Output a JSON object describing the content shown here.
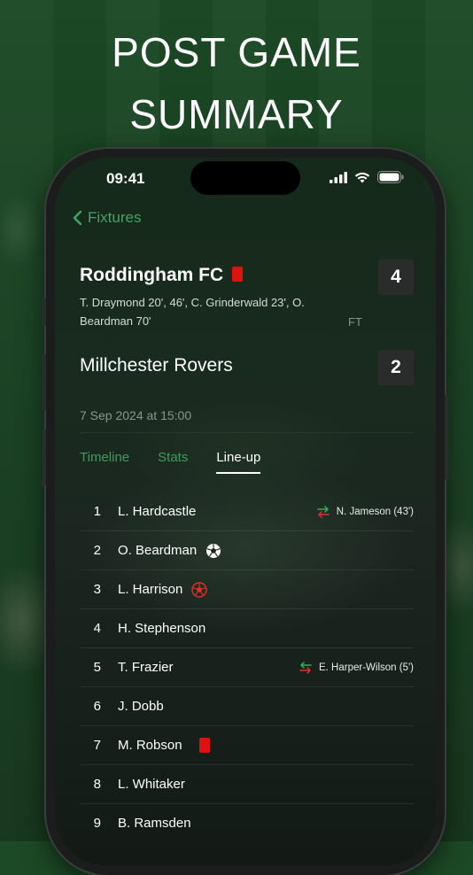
{
  "headline": {
    "line1": "POST GAME",
    "line2": "SUMMARY"
  },
  "status_bar": {
    "time": "09:41"
  },
  "nav": {
    "back_label": "Fixtures"
  },
  "match": {
    "home": {
      "name": "Roddingham FC",
      "score": "4",
      "scorers": "T. Draymond 20', 46', C. Grinderwald 23', O. Beardman 70'"
    },
    "away": {
      "name": "Millchester Rovers",
      "score": "2"
    },
    "status": "FT",
    "datetime": "7 Sep 2024 at 15:00"
  },
  "tabs": [
    {
      "label": "Timeline",
      "active": false
    },
    {
      "label": "Stats",
      "active": false
    },
    {
      "label": "Line-up",
      "active": true
    }
  ],
  "lineup": [
    {
      "number": "1",
      "name": "L. Hardcastle",
      "icon": null,
      "sub": "N. Jameson (43')"
    },
    {
      "number": "2",
      "name": "O. Beardman",
      "icon": "goal-ball-icon",
      "sub": null
    },
    {
      "number": "3",
      "name": "L. Harrison",
      "icon": "own-goal-ball-icon",
      "sub": null
    },
    {
      "number": "4",
      "name": "H. Stephenson",
      "icon": null,
      "sub": null
    },
    {
      "number": "5",
      "name": "T. Frazier",
      "icon": null,
      "sub": "E. Harper-Wilson (5')"
    },
    {
      "number": "6",
      "name": "J. Dobb",
      "icon": null,
      "sub": null
    },
    {
      "number": "7",
      "name": "M. Robson",
      "icon": "red-card-icon",
      "sub": null
    },
    {
      "number": "8",
      "name": "L. Whitaker",
      "icon": null,
      "sub": null
    },
    {
      "number": "9",
      "name": "B. Ramsden",
      "icon": null,
      "sub": null
    }
  ],
  "colors": {
    "accent_green": "#3fa468",
    "red_card": "#e0120f",
    "sub_in": "#2fb35a",
    "sub_out": "#e0312a"
  }
}
